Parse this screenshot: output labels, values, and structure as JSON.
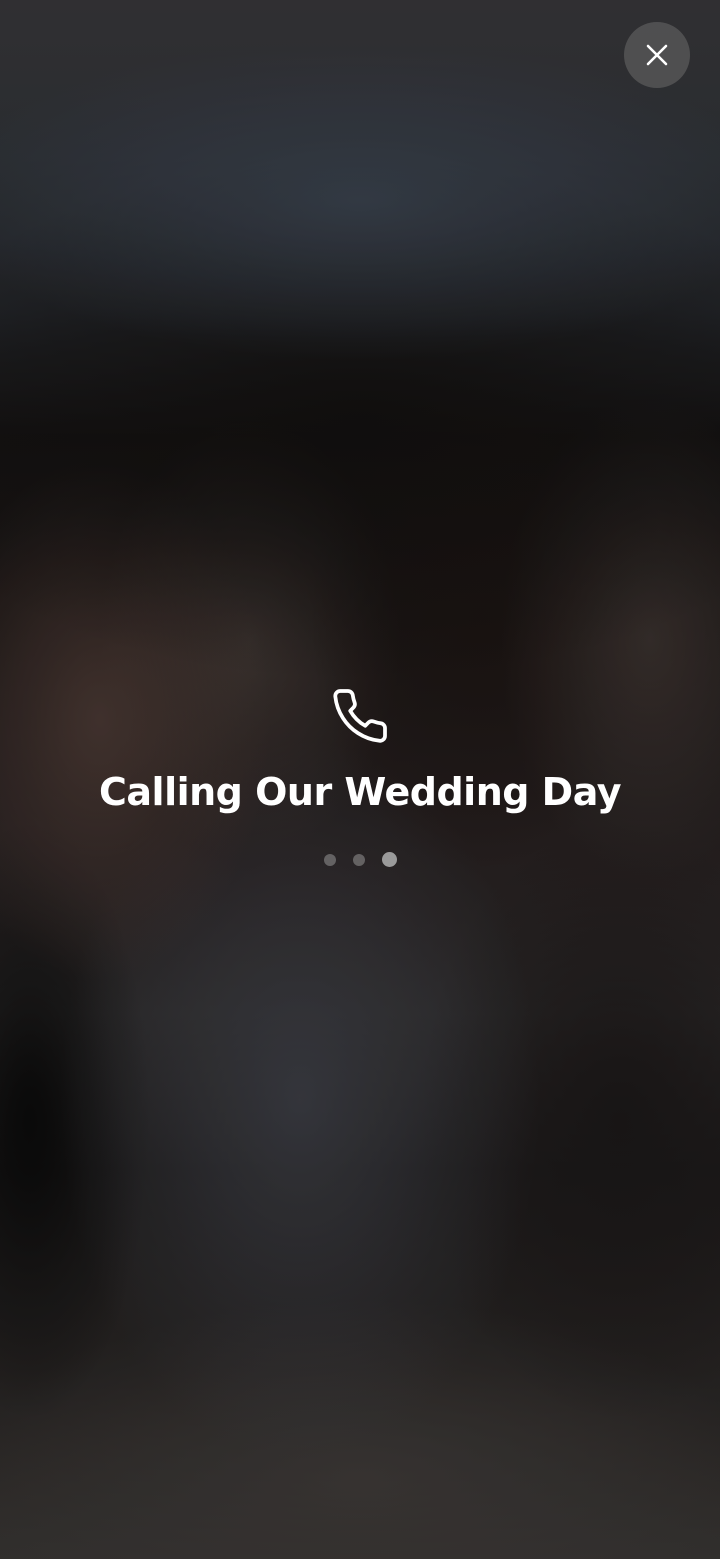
{
  "screen": {
    "title": "Calling Our Wedding Day"
  },
  "icons": {
    "close": "close-icon",
    "phone": "phone-icon"
  },
  "pager": {
    "total": 3,
    "active_index": 2
  },
  "colors": {
    "text": "#ffffff",
    "close_button_bg": "#646464"
  }
}
